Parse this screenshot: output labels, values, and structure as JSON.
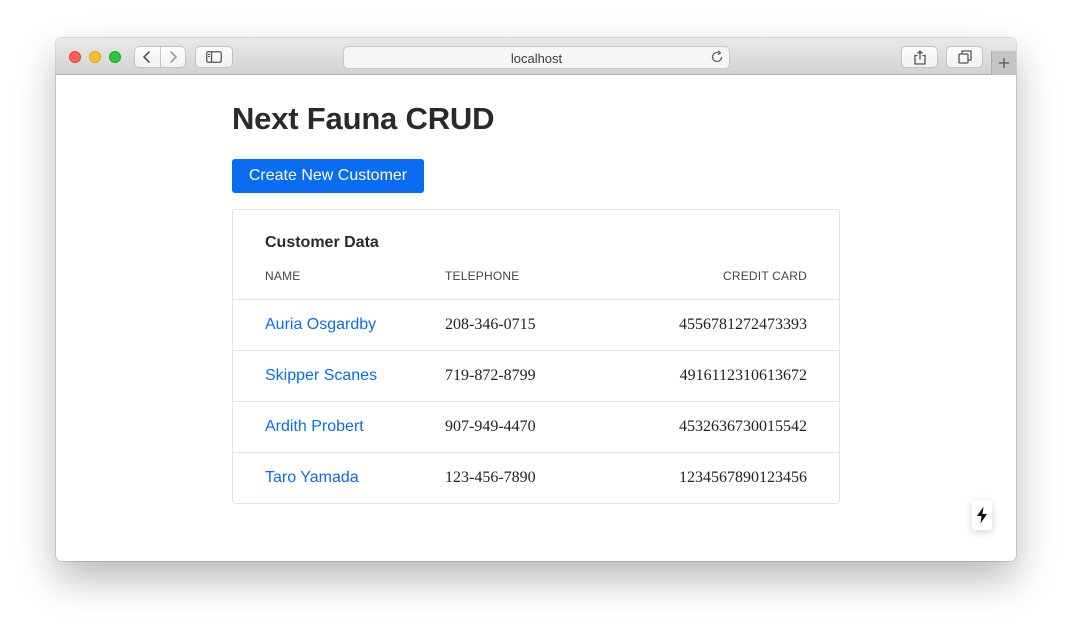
{
  "browser": {
    "url": "localhost",
    "icons": {
      "back": "chevron-left-icon",
      "forward": "chevron-right-icon",
      "sidebar": "sidebar-icon",
      "reload": "reload-icon",
      "share": "share-icon",
      "tabs": "tabs-overview-icon",
      "new_tab": "plus-icon"
    }
  },
  "page": {
    "title": "Next Fauna CRUD",
    "create_button_label": "Create New Customer",
    "accent_color": "#0a6cf0"
  },
  "table": {
    "title": "Customer Data",
    "headers": {
      "name": "NAME",
      "telephone": "TELEPHONE",
      "credit_card": "CREDIT CARD"
    },
    "rows": [
      {
        "name": "Auria Osgardby",
        "telephone": "208-346-0715",
        "credit_card": "4556781272473393"
      },
      {
        "name": "Skipper Scanes",
        "telephone": "719-872-8799",
        "credit_card": "4916112310613672"
      },
      {
        "name": "Ardith Probert",
        "telephone": "907-949-4470",
        "credit_card": "4532636730015542"
      },
      {
        "name": "Taro Yamada",
        "telephone": "123-456-7890",
        "credit_card": "1234567890123456"
      }
    ]
  },
  "dev_indicator": {
    "icon": "lightning-bolt-icon"
  }
}
